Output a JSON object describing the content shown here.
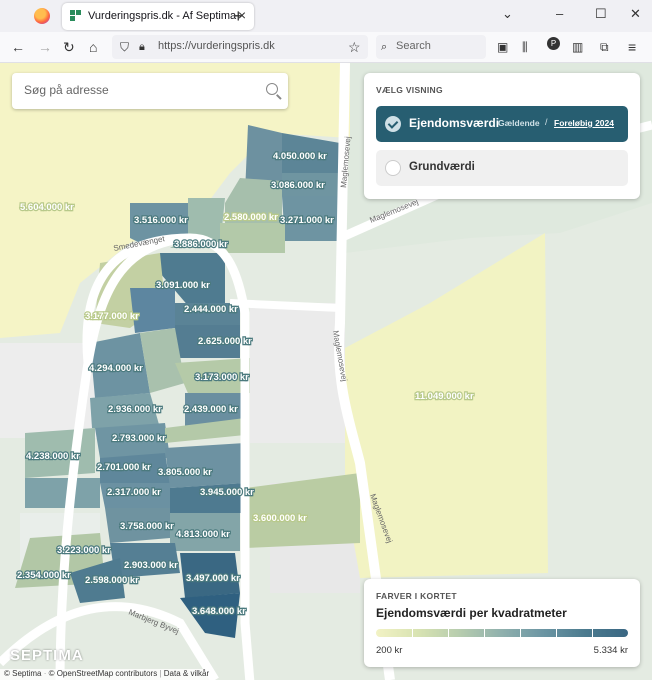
{
  "browser": {
    "tab_title": "Vurderingspris.dk - Af Septima",
    "url": "https://vurderingspris.dk",
    "search_placeholder": "Search"
  },
  "search": {
    "placeholder": "Søg på adresse"
  },
  "view_panel": {
    "heading": "VÆLG VISNING",
    "options": [
      {
        "label": "Ejendomsværdi",
        "selected": true
      },
      {
        "label": "Grundværdi",
        "selected": false
      }
    ],
    "status_current": "Gældende",
    "separator": "/",
    "status_preliminary": "Foreløbig 2024"
  },
  "legend": {
    "heading": "FARVER I KORTET",
    "title": "Ejendomsværdi per kvadratmeter",
    "min": "200 kr",
    "max": "5.334 kr"
  },
  "roads": {
    "smedevaenget": "Smedevænget",
    "maglemosevej_1": "Maglemosevej",
    "maglemosevej_2": "Maglemosevej",
    "maglemosevej_3": "Maglemosevej",
    "marbjerg": "Marbjerg Byvej"
  },
  "map_labels": [
    "5.604.000 kr",
    "4.050.000 kr",
    "3.086.000 kr",
    "3.271.000 kr",
    "3.516.000 kr",
    "2.580.000 kr",
    "3.886.000 kr",
    "3.091.000 kr",
    "3.177.000 kr",
    "2.444.000 kr",
    "2.625.000 kr",
    "4.294.000 kr",
    "3.173.000 kr",
    "11.049.000 kr",
    "2.936.000 kr",
    "2.439.000 kr",
    "2.793.000 kr",
    "4.238.000 kr",
    "2.701.000 kr",
    "3.805.000 kr",
    "2.317.000 kr",
    "3.945.000 kr",
    "3.600.000 kr",
    "3.758.000 kr",
    "4.813.000 kr",
    "3.223.000 kr",
    "2.354.000 kr",
    "2.903.000 kr",
    "2.598.000 kr",
    "3.497.000 kr",
    "3.648.000 kr"
  ],
  "brand": "SEPTIMA",
  "attribution": {
    "septima": "© Septima",
    "osm": "© OpenStreetMap contributors",
    "data": "Data & vilkår"
  }
}
